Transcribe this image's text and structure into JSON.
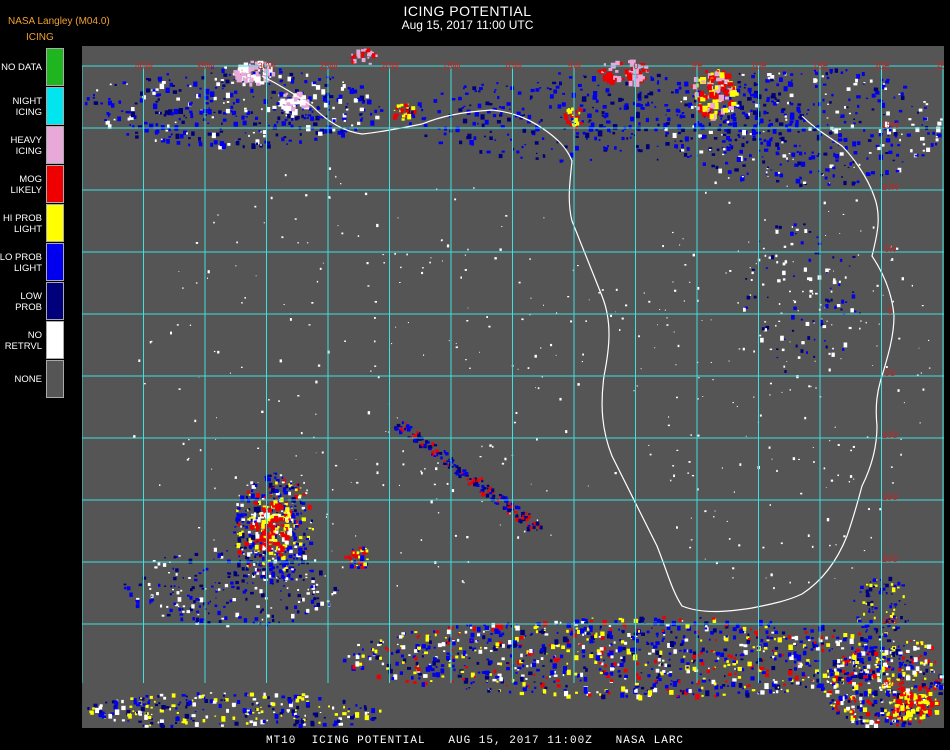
{
  "header": {
    "source": "NASA Langley (M04.0)",
    "title": "ICING POTENTIAL",
    "subtitle": "Aug 15, 2017 11:00 UTC",
    "legend_title": "ICING"
  },
  "legend": [
    {
      "label": "NO DATA",
      "color": "#1fb51f"
    },
    {
      "label": "NIGHT\nICING",
      "color": "#00e5ee"
    },
    {
      "label": "HEAVY\nICING",
      "color": "#e8a8d8"
    },
    {
      "label": "MOG\nLIKELY",
      "color": "#ee0000"
    },
    {
      "label": "HI PROB\nLIGHT",
      "color": "#ffff00"
    },
    {
      "label": "LO PROB\nLIGHT",
      "color": "#0000ee"
    },
    {
      "label": "LOW\nPROB",
      "color": "#00007a"
    },
    {
      "label": "NO\nRETRVL",
      "color": "#ffffff"
    },
    {
      "label": "NONE",
      "color": "#555555"
    }
  ],
  "map": {
    "background": "#555555",
    "grid_color": "#40e0e0",
    "coast_color": "#ffffff",
    "label_color": "#cc2222",
    "longitude_labels": [
      "40W",
      "35W",
      "30W",
      "25W",
      "20W",
      "15W",
      "10W",
      "5W",
      "0",
      "5E",
      "10E",
      "15E",
      "20E",
      "25E"
    ],
    "latitude_labels": [
      "15N",
      "10N",
      "5N",
      "0",
      "5S",
      "10S",
      "15S",
      "20S",
      "25S",
      "30S",
      "35S"
    ]
  },
  "footer": "MT10  ICING POTENTIAL   AUG 15, 2017 11:00Z   NASA LARC"
}
